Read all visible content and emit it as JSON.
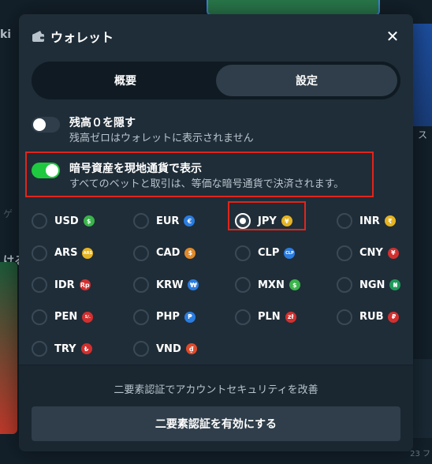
{
  "modal": {
    "title": "ウォレット",
    "close_icon": "close-icon",
    "wallet_icon": "wallet-icon"
  },
  "tabs": [
    {
      "label": "概要",
      "active": false
    },
    {
      "label": "設定",
      "active": true
    }
  ],
  "settings": {
    "hide_zero": {
      "label": "残高０を隠す",
      "description": "残高ゼロはウォレットに表示されません",
      "enabled": false
    },
    "display_fiat": {
      "label": "暗号資産を現地通貨で表示",
      "description": "すべてのベットと取引は、等価な暗号通貨で決済されます。",
      "enabled": true
    }
  },
  "currencies": [
    {
      "code": "USD",
      "symbol": "$",
      "color": "#3ab54a",
      "selected": false
    },
    {
      "code": "EUR",
      "symbol": "€",
      "color": "#2a7de1",
      "selected": false
    },
    {
      "code": "JPY",
      "symbol": "¥",
      "color": "#e6b422",
      "selected": true
    },
    {
      "code": "INR",
      "symbol": "₹",
      "color": "#e6b422",
      "selected": false
    },
    {
      "code": "ARS",
      "symbol": "ARS",
      "color": "#e6b422",
      "selected": false
    },
    {
      "code": "CAD",
      "symbol": "$",
      "color": "#e08a2a",
      "selected": false
    },
    {
      "code": "CLP",
      "symbol": "CLP",
      "color": "#2a7de1",
      "selected": false
    },
    {
      "code": "CNY",
      "symbol": "¥",
      "color": "#d32f2f",
      "selected": false
    },
    {
      "code": "IDR",
      "symbol": "Rp",
      "color": "#d32f2f",
      "selected": false
    },
    {
      "code": "KRW",
      "symbol": "₩",
      "color": "#2a7de1",
      "selected": false
    },
    {
      "code": "MXN",
      "symbol": "$",
      "color": "#3ab54a",
      "selected": false
    },
    {
      "code": "NGN",
      "symbol": "₦",
      "color": "#1e9a5a",
      "selected": false
    },
    {
      "code": "PEN",
      "symbol": "S/.",
      "color": "#d32f2f",
      "selected": false
    },
    {
      "code": "PHP",
      "symbol": "₱",
      "color": "#2a7de1",
      "selected": false
    },
    {
      "code": "PLN",
      "symbol": "zł",
      "color": "#d32f2f",
      "selected": false
    },
    {
      "code": "RUB",
      "symbol": "₽",
      "color": "#d32f2f",
      "selected": false
    },
    {
      "code": "TRY",
      "symbol": "₺",
      "color": "#d32f2f",
      "selected": false
    },
    {
      "code": "VND",
      "symbol": "₫",
      "color": "#e04a2a",
      "selected": false
    }
  ],
  "footer": {
    "text": "二要素認証でアカウントセキュリティを改善",
    "button_label": "二要素認証を有効にする"
  },
  "background": {
    "left_text": "ki",
    "left_text2": "ける",
    "left_faint": "ゲ",
    "right_text": "ス",
    "bottom_right": "23 フ"
  },
  "colors": {
    "accent_green": "#1ec940",
    "highlight_red": "#e0251b",
    "modal_bg": "#1f2d38"
  }
}
